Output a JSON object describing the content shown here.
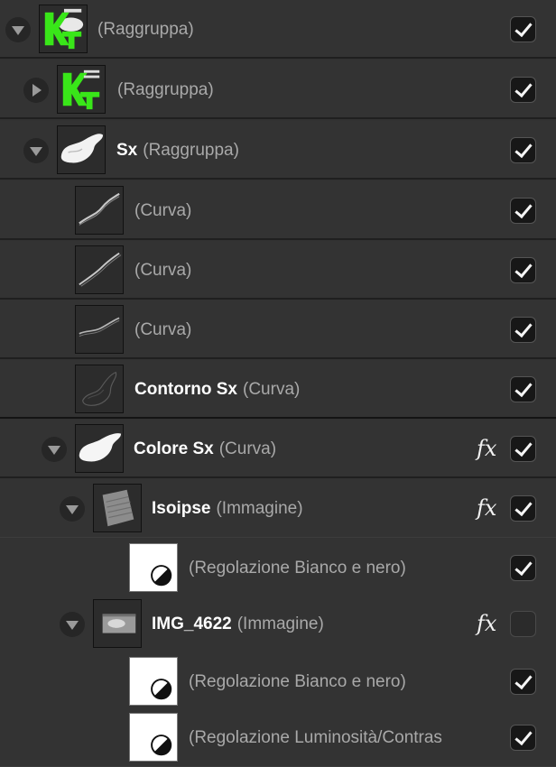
{
  "layers": [
    {
      "name": "",
      "type": "(Raggruppa)",
      "expanded": true,
      "has_fx": false,
      "visible": true,
      "thumb": "krash-logo-green"
    },
    {
      "name": "",
      "type": "(Raggruppa)",
      "expanded": false,
      "has_fx": false,
      "visible": true,
      "thumb": "krash-logo-green"
    },
    {
      "name": "Sx",
      "type": "(Raggruppa)",
      "expanded": true,
      "has_fx": false,
      "visible": true,
      "thumb": "white-blob"
    },
    {
      "name": "",
      "type": "(Curva)",
      "has_fx": false,
      "visible": true,
      "thumb": "curve-stroke"
    },
    {
      "name": "",
      "type": "(Curva)",
      "has_fx": false,
      "visible": true,
      "thumb": "curve-stroke"
    },
    {
      "name": "",
      "type": "(Curva)",
      "has_fx": false,
      "visible": true,
      "thumb": "curve-stroke"
    },
    {
      "name": "Contorno Sx",
      "type": "(Curva)",
      "has_fx": false,
      "visible": true,
      "thumb": "outline"
    },
    {
      "name": "Colore Sx",
      "type": "(Curva)",
      "expanded": true,
      "has_fx": true,
      "visible": true,
      "thumb": "white-blob"
    },
    {
      "name": "Isoipse",
      "type": "(Immagine)",
      "expanded": true,
      "has_fx": true,
      "visible": true,
      "thumb": "contour-image"
    },
    {
      "name": "",
      "type": "(Regolazione Bianco e nero)",
      "has_fx": false,
      "visible": true,
      "thumb": "adjustment-icon"
    },
    {
      "name": "IMG_4622",
      "type": "(Immagine)",
      "expanded": true,
      "has_fx": true,
      "visible": false,
      "thumb": "photo"
    },
    {
      "name": "",
      "type": "(Regolazione Bianco e nero)",
      "has_fx": false,
      "visible": true,
      "thumb": "adjustment-icon"
    },
    {
      "name": "",
      "type": "(Regolazione Luminosità/Contras",
      "has_fx": false,
      "visible": true,
      "thumb": "adjustment-icon"
    }
  ],
  "fx_label": "fx"
}
